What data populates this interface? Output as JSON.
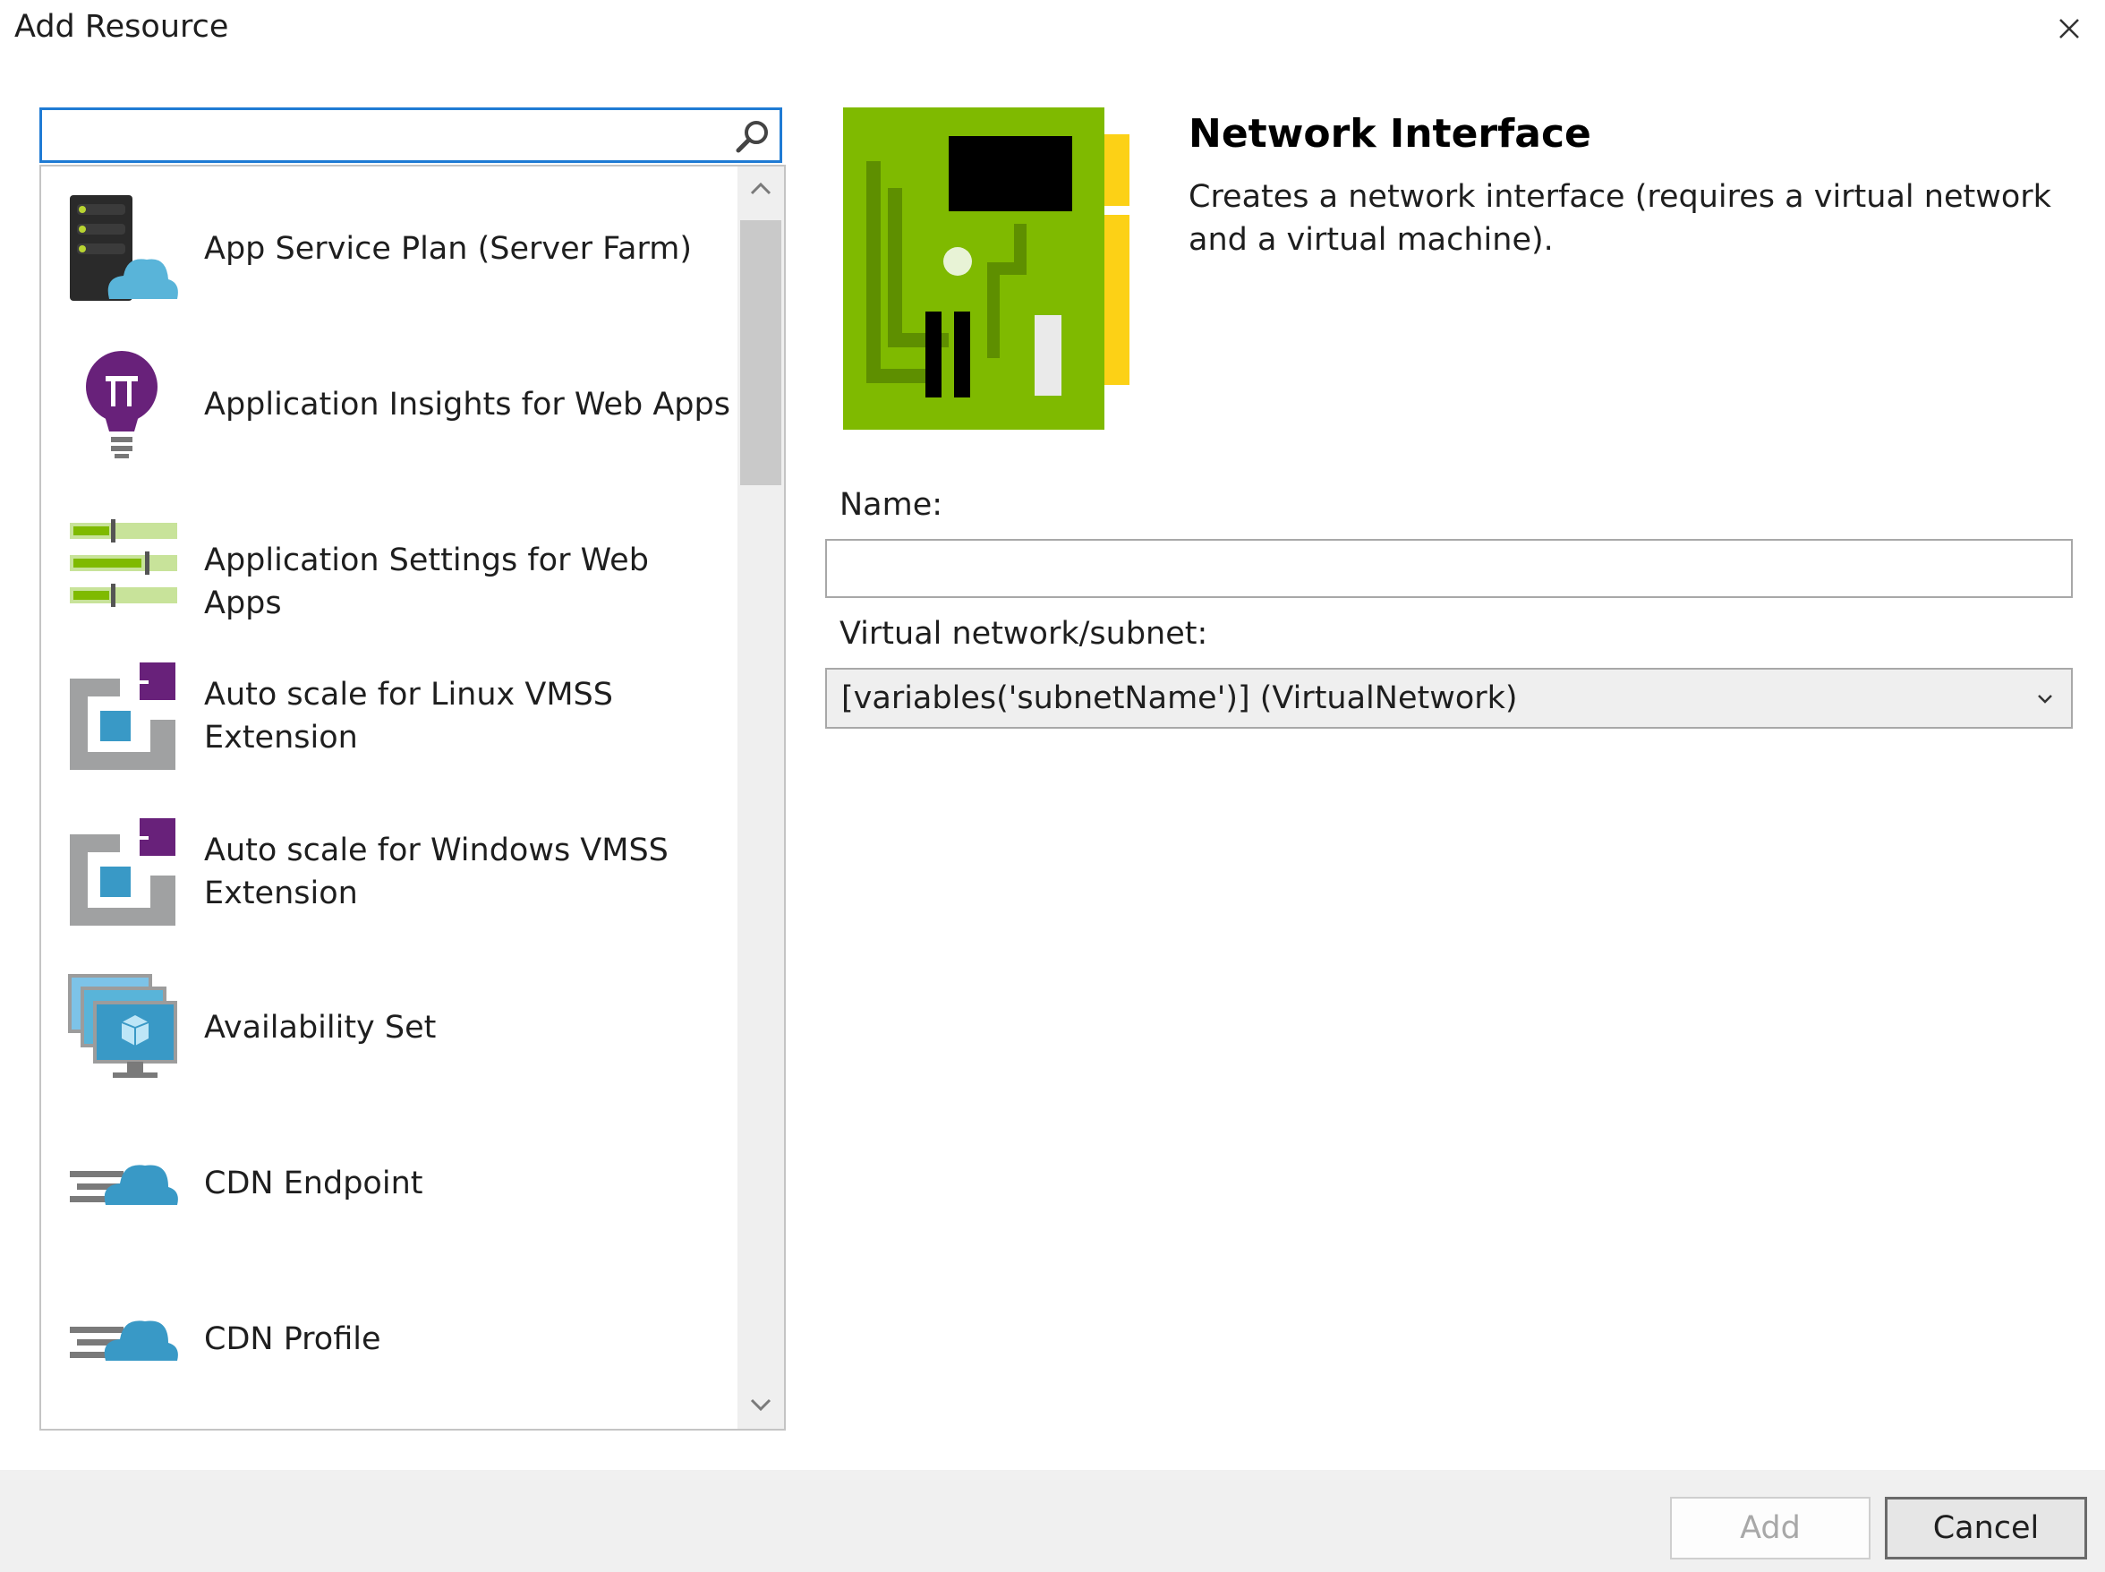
{
  "dialog": {
    "title": "Add Resource"
  },
  "search": {
    "value": "",
    "placeholder": ""
  },
  "list": {
    "items": [
      {
        "label": "App Service Plan (Server Farm)",
        "icon": "server-farm-icon"
      },
      {
        "label": "Application Insights for Web Apps",
        "icon": "lightbulb-icon"
      },
      {
        "label": "Application Settings for Web Apps",
        "icon": "sliders-icon"
      },
      {
        "label": "Auto scale for Linux VMSS\nExtension",
        "icon": "autoscale-icon"
      },
      {
        "label": "Auto scale for Windows VMSS\nExtension",
        "icon": "autoscale-icon"
      },
      {
        "label": "Availability Set",
        "icon": "availability-set-icon"
      },
      {
        "label": "CDN Endpoint",
        "icon": "cdn-cloud-icon"
      },
      {
        "label": "CDN Profile",
        "icon": "cdn-cloud-icon"
      }
    ]
  },
  "detail": {
    "title": "Network Interface",
    "description": "Creates a network interface (requires a virtual network and a virtual machine).",
    "icon": "network-card-icon"
  },
  "form": {
    "name_label": "Name:",
    "name_value": "",
    "subnet_label": "Virtual network/subnet:",
    "subnet_value": "[variables('subnetName')] (VirtualNetwork)"
  },
  "footer": {
    "add_label": "Add",
    "cancel_label": "Cancel"
  },
  "colors": {
    "accent": "#1f7bd4",
    "nic_green": "#7fba00",
    "nic_gold": "#fcd116"
  }
}
